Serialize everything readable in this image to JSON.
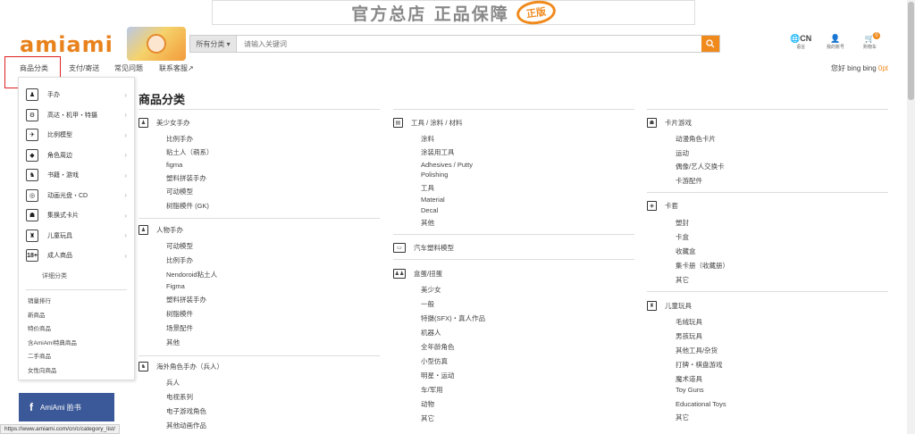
{
  "banner": {
    "text": "官方总店 正品保障",
    "stamp": "正版"
  },
  "header": {
    "logo": "amiami",
    "search": {
      "category": "所有分类",
      "placeholder": "请输入关键词"
    },
    "utils": [
      {
        "main": "🌐CN",
        "sub": "语言"
      },
      {
        "main": "👤",
        "sub": "我的账号"
      },
      {
        "main": "🛒",
        "sub": "购物车",
        "badge": "0"
      }
    ]
  },
  "nav": {
    "items": [
      "商品分类",
      "支付/寄送",
      "常见问题",
      "联系客服↗"
    ],
    "greeting": "您好 bing bing ",
    "points": "0pt"
  },
  "menu": {
    "items": [
      {
        "icon": "♟",
        "label": "手办"
      },
      {
        "icon": "⚙",
        "label": "高达・机甲・特摄"
      },
      {
        "icon": "✈",
        "label": "比例模型"
      },
      {
        "icon": "◆",
        "label": "角色周边"
      },
      {
        "icon": "♞",
        "label": "书籍・游戏"
      },
      {
        "icon": "◎",
        "label": "动画光盘・CD"
      },
      {
        "icon": "☗",
        "label": "集换式卡片"
      },
      {
        "icon": "♜",
        "label": "儿童玩具"
      },
      {
        "icon": "18+",
        "label": "成人商品"
      }
    ],
    "detail": "详细分类",
    "links": [
      "销量排行",
      "新商品",
      "特价商品",
      "含AmiAmi特典商品",
      "二手商品",
      "女性向商品"
    ]
  },
  "facebook": {
    "icon": "f",
    "label": "AmiAmi 脸书"
  },
  "status_url": "https://www.amiami.com/cn/c/category_list/",
  "page": {
    "heading": "商品分类"
  },
  "categories": {
    "c1": {
      "icon": "♟",
      "title": "美少女手办",
      "subs": [
        "比例手办",
        "粘土人（萌系）",
        "figma",
        "塑料拼装手办",
        "可动模型",
        "树脂模件 (GK)"
      ]
    },
    "c2": {
      "icon": "♟",
      "title": "人物手办",
      "subs": [
        "可动模型",
        "比例手办",
        "Nendoroid粘土人",
        "Figma",
        "塑料拼装手办",
        "树脂模件",
        "场景配件",
        "其他"
      ]
    },
    "c3": {
      "icon": "♞",
      "title": "海外角色手办（兵人）",
      "subs": [
        "兵人",
        "电视系列",
        "电子游戏角色",
        "其他动画作品"
      ]
    },
    "c4": {
      "icon": "▤",
      "title": "工具 / 涂料 / 材料",
      "subs": [
        "涂料",
        "涂装用工具",
        "Adhesives / Putty",
        "Polishing",
        "工具",
        "Material",
        "Decal",
        "其他"
      ]
    },
    "c5": {
      "icon": "▭",
      "title": "汽车塑料模型",
      "subs": []
    },
    "c6": {
      "icon": "♟♟",
      "title": "盒蛋/扭蛋",
      "subs": [
        "美少女",
        "一般",
        "特摄(SFX)・真人作品",
        "机器人",
        "全年龄角色",
        "小型仿真",
        "明星・运动",
        "车/军用",
        "动物",
        "其它"
      ]
    },
    "c7": {
      "icon": "☗",
      "title": "卡片游戏",
      "subs": [
        "动漫角色卡片",
        "运动",
        "偶像/艺人交换卡",
        "卡游配件"
      ]
    },
    "c8": {
      "icon": "◈",
      "title": "卡套",
      "subs": [
        "塑封",
        "卡盒",
        "收藏盒",
        "集卡册（收藏册）",
        "其它"
      ]
    },
    "c9": {
      "icon": "♜",
      "title": "儿童玩具",
      "subs": [
        "毛绒玩具",
        "男孩玩具",
        "其他工具/杂货",
        "打牌・棋盘游戏",
        "魔术道具",
        "Toy Guns",
        "Educational Toys",
        "其它"
      ]
    }
  }
}
